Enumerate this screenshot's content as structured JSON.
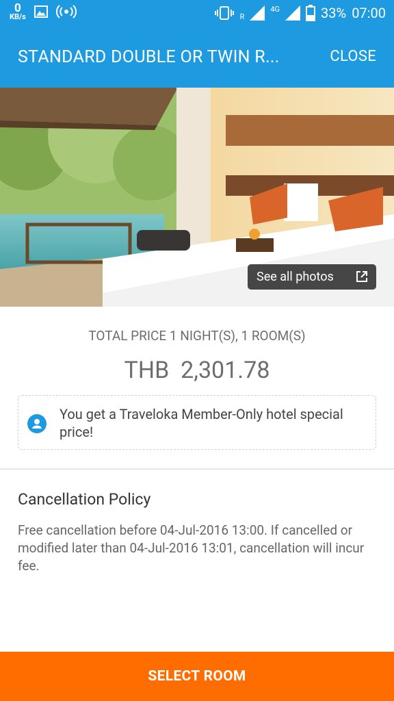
{
  "status_bar": {
    "net_speed_value": "0",
    "net_speed_unit": "KB/s",
    "roaming": "R",
    "network": "4G",
    "battery": "33%",
    "time": "07:00"
  },
  "header": {
    "title": "STANDARD DOUBLE OR TWIN R...",
    "close_label": "CLOSE"
  },
  "photos": {
    "see_all_label": "See all photos"
  },
  "pricing": {
    "total_label": "TOTAL PRICE 1 NIGHT(S), 1 ROOM(S)",
    "currency": "THB",
    "amount": "2,301.78",
    "member_message": "You get a Traveloka Member-Only hotel special price!"
  },
  "cancellation": {
    "title": "Cancellation Policy",
    "text": "Free cancellation before 04-Jul-2016 13:00. If cancelled or modified later than 04-Jul-2016 13:01, cancellation will incur fee."
  },
  "footer": {
    "select_label": "SELECT ROOM"
  },
  "colors": {
    "primary": "#1e9be0",
    "cta": "#ff6d00"
  }
}
